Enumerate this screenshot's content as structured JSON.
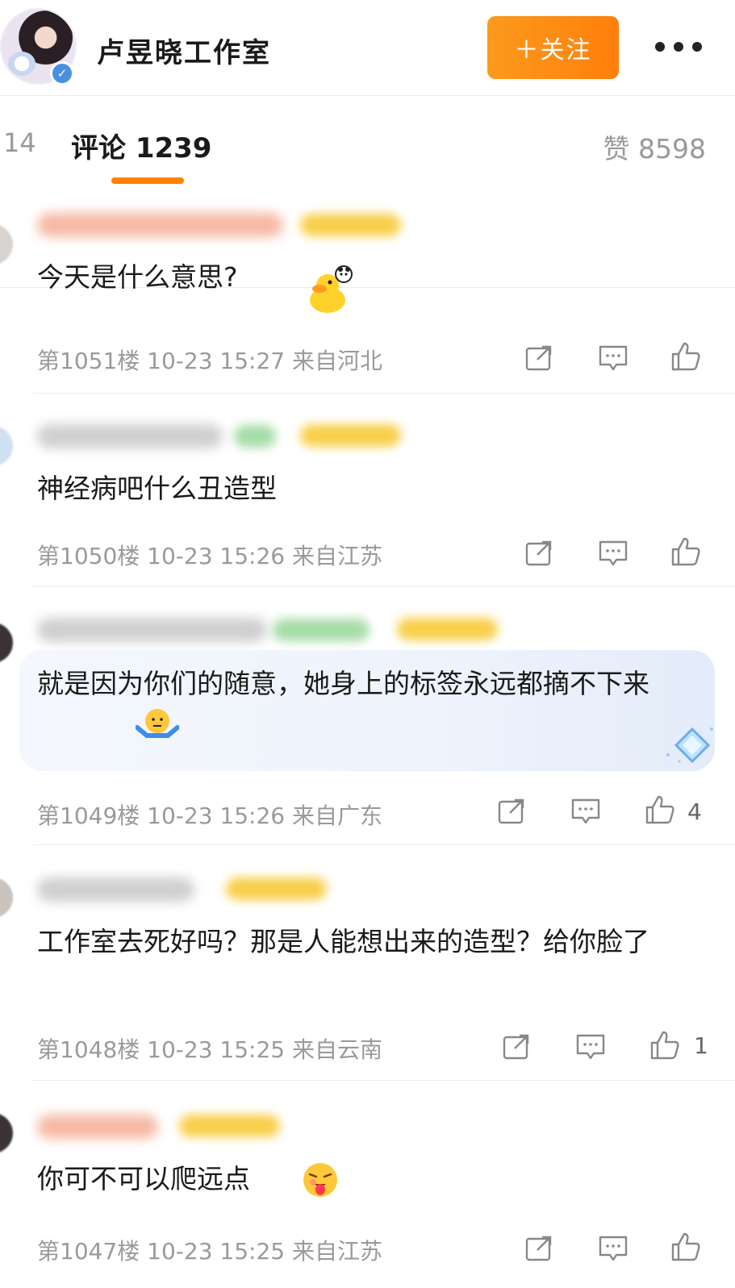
{
  "header": {
    "title": "卢昱晓工作室",
    "follow_label": "＋关注"
  },
  "tabs": {
    "reposts_partial": "14",
    "comments_label": "评论 1239",
    "likes_label": "赞 8598"
  },
  "comments": [
    {
      "text": "今天是什么意思?",
      "meta": "第1051楼 10-23 15:27 来自河北",
      "likes": ""
    },
    {
      "text": "神经病吧什么丑造型",
      "meta": "第1050楼 10-23 15:26 来自江苏",
      "likes": ""
    },
    {
      "text": "就是因为你们的随意，她身上的标签永远都摘不下来",
      "meta": "第1049楼 10-23 15:26 来自广东",
      "likes": "4"
    },
    {
      "text": "工作室去死好吗？那是人能想出来的造型？给你脸了",
      "meta": "第1048楼 10-23 15:25 来自云南",
      "likes": "1"
    },
    {
      "text": "你可不可以爬远点",
      "meta": "第1047楼 10-23 15:25 来自江苏",
      "likes": ""
    }
  ],
  "colors": {
    "accent": "#ff8200",
    "follow_button": "#fb9a1e"
  }
}
